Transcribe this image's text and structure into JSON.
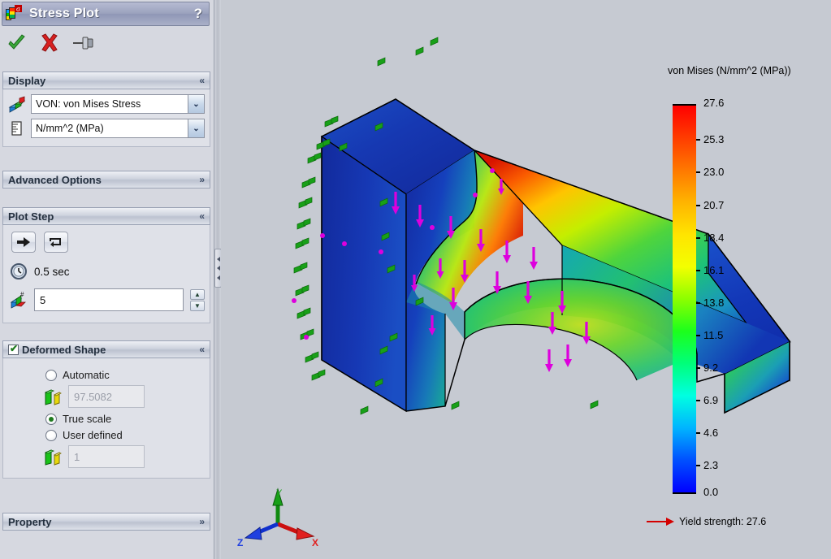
{
  "window": {
    "title": "Stress Plot",
    "icon": "stress-plot-icon",
    "help_label": "?"
  },
  "toolbar": {
    "ok_label": "OK",
    "cancel_label": "Cancel",
    "pin_label": "Keep Visible"
  },
  "sections": {
    "display": {
      "title": "Display",
      "collapse_glyph": "«",
      "component": {
        "icon": "stress-component-icon",
        "value": "VON: von Mises Stress",
        "dropdown_glyph": "⌄"
      },
      "units": {
        "icon": "units-icon",
        "value": "N/mm^2 (MPa)",
        "dropdown_glyph": "⌄"
      }
    },
    "advanced_options": {
      "title": "Advanced Options",
      "collapse_glyph": "»"
    },
    "plot_step": {
      "title": "Plot Step",
      "collapse_glyph": "«",
      "play_button_label": "Play",
      "loop_button_label": "Loop",
      "time_icon": "clock-icon",
      "time_value": "0.5 sec",
      "step_icon": "plot-step-icon",
      "step_value": "5",
      "spin_up_glyph": "▲",
      "spin_down_glyph": "▼"
    },
    "deformed_shape": {
      "title": "Deformed Shape",
      "checked": true,
      "collapse_glyph": "«",
      "options": [
        {
          "label": "Automatic",
          "selected": false
        },
        {
          "label": "True scale",
          "selected": true
        },
        {
          "label": "User defined",
          "selected": false
        }
      ],
      "automatic_scale_icon": "scale-bars-icon",
      "automatic_scale_value": "97.5082",
      "user_scale_icon": "scale-bars-icon",
      "user_scale_value": "1"
    },
    "property": {
      "title": "Property",
      "collapse_glyph": "»"
    }
  },
  "graphics": {
    "legend_title": "von Mises (N/mm^2 (MPa))",
    "yield_label": "Yield strength: 27.6",
    "triad": {
      "x_label": "X",
      "y_label": "Y",
      "z_label": "Z"
    }
  },
  "chart_data": {
    "type": "heatmap",
    "title": "von Mises (N/mm^2 (MPa))",
    "units": "N/mm^2 (MPa)",
    "ylim": [
      0.0,
      27.6
    ],
    "tick_labels": [
      "27.6",
      "25.3",
      "23.0",
      "20.7",
      "18.4",
      "16.1",
      "13.8",
      "11.5",
      "9.2",
      "6.9",
      "4.6",
      "2.3",
      "0.0"
    ],
    "values": [
      27.6,
      25.3,
      23.0,
      20.7,
      18.4,
      16.1,
      13.8,
      11.5,
      9.2,
      6.9,
      4.6,
      2.3,
      0.0
    ],
    "colormap": [
      "#ff0000",
      "#ff3c00",
      "#ff7800",
      "#ffb400",
      "#ffe400",
      "#f3ff00",
      "#8cff00",
      "#1cff1c",
      "#00ff7a",
      "#00ffe1",
      "#00b4ff",
      "#0050ff",
      "#0000ff"
    ],
    "annotations": [
      "Yield strength: 27.6"
    ],
    "legend_position": "right",
    "colors": {
      "max": "#ff0000",
      "min": "#0000ff",
      "yield_marker": "#d40000",
      "fixture_arrows": "#1f9e1f",
      "load_arrows": "#e000e0",
      "background": "#c6cad2"
    }
  }
}
